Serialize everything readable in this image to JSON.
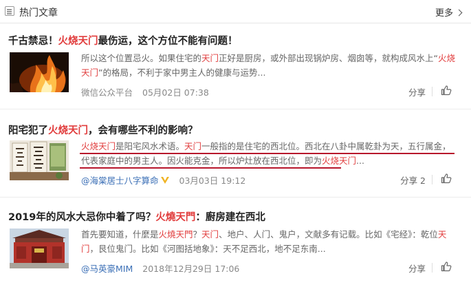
{
  "header": {
    "title": "热门文章",
    "more_label": "更多"
  },
  "articles": [
    {
      "title_prefix": "千古禁忌！",
      "title_keyword": "火烧天门",
      "title_suffix": "最伤运，这个方位不能有问题！",
      "snippet": [
        {
          "t": "所以这个位置忌火。如果住宅的",
          "k": false
        },
        {
          "t": "天门",
          "k": true
        },
        {
          "t": "正好是厨房，或外部出现锅炉房、烟囱等，就构成风水上“",
          "k": false
        },
        {
          "t": "火烧天门",
          "k": true
        },
        {
          "t": "”的格局，不利于家中男主人的健康与运势...",
          "k": false
        }
      ],
      "source": "微信公众平台",
      "date": "05月02日 07:38",
      "share_label": "分享"
    },
    {
      "title_prefix": "阳宅犯了",
      "title_keyword": "火烧天门",
      "title_suffix": "，会有哪些不利的影响？",
      "snippet": [
        {
          "t": "火烧天门",
          "k": true
        },
        {
          "t": "是阳宅风水术语。",
          "k": false
        },
        {
          "t": "天门",
          "k": true
        },
        {
          "t": "一般指的是住宅的西北位。西北在八卦中属乾卦为天，五行属金，代表家庭中的男主人。因火能克金，所以炉灶放在西北位，即为",
          "k": false
        },
        {
          "t": "火烧天门",
          "k": true
        },
        {
          "t": "...",
          "k": false
        }
      ],
      "source": "@海棠居士八字算命",
      "date": "03月03日 19:12",
      "share_label": "分享 2"
    },
    {
      "title_prefix": "2019年的风水大忌你中着了吗？",
      "title_keyword": "火燒天門",
      "title_suffix": "：廚房建在西北",
      "snippet": [
        {
          "t": "首先要知道，什麼是",
          "k": false
        },
        {
          "t": "火燒天門",
          "k": true
        },
        {
          "t": "？",
          "k": false
        },
        {
          "t": "天门",
          "k": true
        },
        {
          "t": "、地户、人门、鬼户，文献多有记载。比如《宅经》：乾位",
          "k": false
        },
        {
          "t": "天门",
          "k": true
        },
        {
          "t": "，艮位鬼门。比如《河图括地象》：天不足西北，地不足东南...",
          "k": false
        }
      ],
      "source": "@马英豪MIM",
      "date": "2018年12月29日 17:06",
      "share_label": "分享"
    }
  ],
  "icons": {
    "header": "article-list-icon",
    "more": "chevron-right-icon",
    "like": "thumbs-up-icon",
    "verified": "verified-v-icon"
  },
  "colors": {
    "keyword": "#e13c3c",
    "underline": "#b7162b",
    "source_link": "#3b6fb6"
  }
}
